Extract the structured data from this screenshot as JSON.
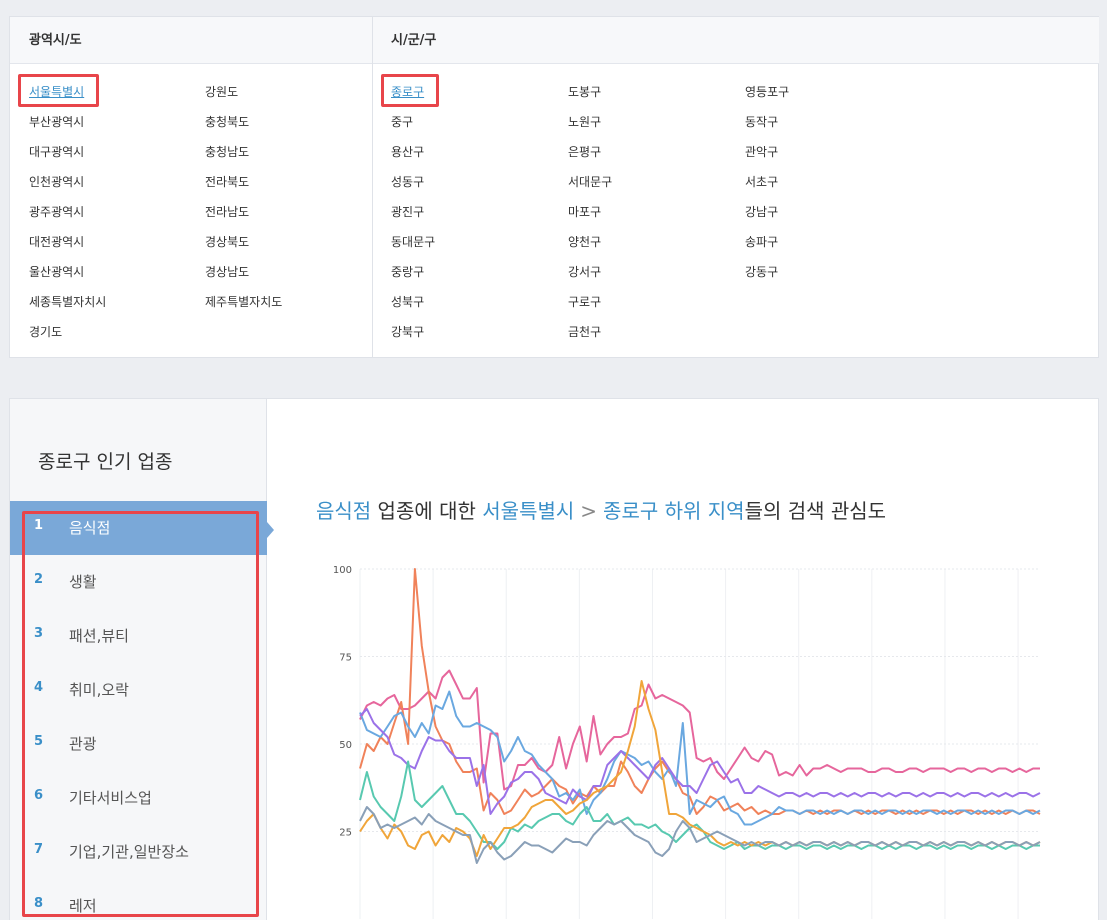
{
  "region": {
    "province_header": "광역시/도",
    "district_header": "시/군/구",
    "provinces": [
      "서울특별시",
      "부산광역시",
      "대구광역시",
      "인천광역시",
      "광주광역시",
      "대전광역시",
      "울산광역시",
      "세종특별자치시",
      "경기도",
      "강원도",
      "충청북도",
      "충청남도",
      "전라북도",
      "전라남도",
      "경상북도",
      "경상남도",
      "제주특별자치도"
    ],
    "districts": [
      "종로구",
      "중구",
      "용산구",
      "성동구",
      "광진구",
      "동대문구",
      "중랑구",
      "성북구",
      "강북구",
      "도봉구",
      "노원구",
      "은평구",
      "서대문구",
      "마포구",
      "양천구",
      "강서구",
      "구로구",
      "금천구",
      "영등포구",
      "동작구",
      "관악구",
      "서초구",
      "강남구",
      "송파구",
      "강동구"
    ],
    "selected_province": "서울특별시",
    "selected_district": "종로구"
  },
  "popular": {
    "title": "종로구 인기 업종",
    "categories": [
      {
        "rank": "1",
        "label": "음식점"
      },
      {
        "rank": "2",
        "label": "생활"
      },
      {
        "rank": "3",
        "label": "패션,뷰티"
      },
      {
        "rank": "4",
        "label": "취미,오락"
      },
      {
        "rank": "5",
        "label": "관광"
      },
      {
        "rank": "6",
        "label": "기타서비스업"
      },
      {
        "rank": "7",
        "label": "기업,기관,일반장소"
      },
      {
        "rank": "8",
        "label": "레저"
      }
    ],
    "headline": {
      "category": "음식점",
      "text1": " 업종에 대한 ",
      "region": "서울특별시",
      "separator": ">",
      "district": "종로구 하위 지역",
      "text2": "들의 검색 관심도"
    }
  },
  "colors": {
    "accent": "#3a8fc8",
    "active_bg": "#7aa8d8",
    "highlight": "#e8454a"
  },
  "chart_data": {
    "type": "line",
    "title": "",
    "xlabel": "",
    "ylabel": "",
    "ylim": [
      0,
      100
    ],
    "yticks": [
      "100",
      "75",
      "50",
      "25"
    ],
    "grid": true,
    "x": [
      1,
      2,
      3,
      4,
      5,
      6,
      7,
      8,
      9,
      10,
      11,
      12,
      13,
      14,
      15,
      16,
      17,
      18,
      19,
      20,
      21,
      22,
      23,
      24,
      25,
      26,
      27,
      28,
      29,
      30,
      31,
      32,
      33,
      34,
      35,
      36,
      37,
      38,
      39,
      40,
      41,
      42,
      43,
      44,
      45,
      46,
      47,
      48,
      49,
      50,
      51,
      52,
      53,
      54,
      55,
      56,
      57,
      58,
      59,
      60,
      61,
      62,
      63,
      64,
      65,
      66,
      67,
      68,
      69,
      70,
      71,
      72,
      73,
      74,
      75,
      76,
      77,
      78,
      79,
      80,
      81,
      82,
      83,
      84,
      85,
      86,
      87,
      88,
      89,
      90,
      91,
      92,
      93,
      94,
      95,
      96,
      97,
      98,
      99,
      100
    ],
    "series": [
      {
        "color": "#e6669c",
        "values": [
          57,
          61,
          62,
          61,
          63,
          64,
          60,
          60,
          61,
          63,
          65,
          63,
          69,
          71,
          67,
          63,
          63,
          66,
          39,
          53,
          53,
          37,
          38,
          44,
          44,
          46,
          43,
          42,
          44,
          52,
          43,
          50,
          55,
          45,
          58,
          47,
          50,
          52,
          52,
          53,
          60,
          61,
          67,
          63,
          64,
          63,
          62,
          61,
          59,
          46,
          45,
          46,
          42,
          40,
          43,
          46,
          49,
          46,
          45,
          48,
          47,
          41,
          42,
          41,
          44,
          41,
          43,
          43,
          44,
          43,
          42,
          43,
          43,
          43,
          42,
          42,
          43,
          43,
          42,
          42,
          43,
          43,
          42,
          43,
          43,
          43,
          42,
          43,
          43,
          42,
          43,
          43,
          42,
          43,
          43,
          42,
          43,
          42,
          43,
          43
        ]
      },
      {
        "color": "#f0825a",
        "values": [
          43,
          50,
          48,
          52,
          50,
          56,
          62,
          50,
          100,
          78,
          65,
          55,
          51,
          50,
          45,
          42,
          42,
          43,
          31,
          36,
          34,
          30,
          31,
          34,
          37,
          35,
          36,
          38,
          40,
          38,
          37,
          33,
          36,
          35,
          38,
          36,
          38,
          38,
          45,
          42,
          38,
          36,
          40,
          43,
          45,
          42,
          40,
          36,
          35,
          30,
          32,
          35,
          34,
          31,
          32,
          33,
          31,
          32,
          30,
          31,
          30,
          30,
          31,
          31,
          30,
          31,
          30,
          31,
          30,
          31,
          31,
          30,
          31,
          30,
          31,
          30,
          31,
          31,
          30,
          31,
          30,
          31,
          30,
          31,
          31,
          30,
          31,
          30,
          31,
          31,
          30,
          31,
          30,
          31,
          30,
          31,
          30,
          31,
          31,
          30
        ]
      },
      {
        "color": "#6aa8e0",
        "values": [
          59,
          54,
          53,
          52,
          55,
          58,
          59,
          55,
          52,
          56,
          53,
          61,
          60,
          65,
          58,
          55,
          55,
          56,
          55,
          54,
          52,
          45,
          48,
          52,
          48,
          47,
          44,
          42,
          40,
          35,
          36,
          34,
          37,
          30,
          34,
          36,
          40,
          45,
          48,
          47,
          46,
          44,
          45,
          42,
          40,
          43,
          38,
          56,
          30,
          34,
          33,
          32,
          34,
          35,
          31,
          30,
          27,
          27,
          28,
          29,
          30,
          32,
          31,
          31,
          30,
          31,
          31,
          30,
          31,
          30,
          31,
          30,
          31,
          31,
          30,
          31,
          30,
          31,
          31,
          30,
          31,
          30,
          31,
          31,
          30,
          31,
          30,
          31,
          31,
          30,
          31,
          30,
          31,
          30,
          31,
          31,
          30,
          31,
          30,
          31
        ]
      },
      {
        "color": "#9b72e8",
        "values": [
          58,
          60,
          56,
          54,
          52,
          47,
          46,
          44,
          43,
          48,
          52,
          51,
          51,
          48,
          46,
          46,
          46,
          38,
          44,
          30,
          33,
          35,
          39,
          40,
          42,
          42,
          40,
          36,
          35,
          34,
          33,
          37,
          35,
          34,
          38,
          38,
          44,
          46,
          48,
          46,
          44,
          42,
          40,
          44,
          46,
          43,
          40,
          38,
          38,
          36,
          40,
          44,
          45,
          42,
          39,
          40,
          36,
          36,
          38,
          37,
          36,
          35,
          36,
          36,
          35,
          36,
          35,
          36,
          36,
          35,
          36,
          35,
          36,
          35,
          36,
          36,
          35,
          36,
          35,
          36,
          36,
          35,
          36,
          35,
          36,
          36,
          35,
          36,
          35,
          36,
          36,
          35,
          36,
          35,
          36,
          35,
          36,
          36,
          35,
          36
        ]
      },
      {
        "color": "#58c9b0",
        "values": [
          34,
          42,
          35,
          32,
          30,
          28,
          35,
          45,
          34,
          32,
          34,
          36,
          38,
          34,
          30,
          30,
          28,
          25,
          22,
          22,
          20,
          22,
          26,
          25,
          27,
          26,
          28,
          29,
          30,
          30,
          28,
          27,
          30,
          32,
          28,
          28,
          30,
          27,
          28,
          29,
          27,
          27,
          26,
          27,
          25,
          24,
          22,
          24,
          26,
          27,
          25,
          22,
          21,
          20,
          21,
          22,
          20,
          21,
          21,
          20,
          21,
          21,
          20,
          21,
          21,
          20,
          21,
          21,
          20,
          21,
          20,
          21,
          21,
          20,
          21,
          21,
          20,
          21,
          20,
          21,
          21,
          20,
          21,
          21,
          20,
          21,
          20,
          21,
          21,
          20,
          21,
          21,
          20,
          21,
          20,
          21,
          21,
          20,
          21,
          21
        ]
      },
      {
        "color": "#f0a53a",
        "values": [
          25,
          28,
          30,
          26,
          23,
          27,
          25,
          21,
          20,
          24,
          25,
          21,
          24,
          22,
          26,
          25,
          23,
          18,
          24,
          20,
          23,
          26,
          26,
          27,
          29,
          32,
          33,
          34,
          34,
          32,
          30,
          31,
          33,
          34,
          36,
          37,
          38,
          40,
          42,
          48,
          55,
          68,
          60,
          54,
          42,
          30,
          30,
          29,
          27,
          26,
          25,
          24,
          22,
          21,
          22,
          21,
          22,
          21,
          22,
          21,
          22,
          21,
          22,
          21,
          22,
          21,
          22,
          22,
          21,
          22,
          21,
          22,
          21,
          22,
          22,
          21,
          22,
          21,
          22,
          21,
          22,
          22,
          21,
          22,
          21,
          22,
          21,
          22,
          22,
          21,
          22,
          21,
          22,
          21,
          22,
          22,
          21,
          22,
          21,
          22
        ]
      },
      {
        "color": "#8aa0b8",
        "values": [
          28,
          32,
          30,
          26,
          27,
          26,
          27,
          28,
          29,
          27,
          30,
          28,
          27,
          26,
          25,
          24,
          24,
          16,
          20,
          22,
          19,
          17,
          18,
          20,
          22,
          21,
          21,
          20,
          19,
          21,
          23,
          22,
          22,
          21,
          24,
          26,
          28,
          27,
          28,
          26,
          24,
          23,
          22,
          19,
          18,
          20,
          25,
          28,
          26,
          22,
          23,
          24,
          25,
          24,
          23,
          22,
          21,
          22,
          21,
          22,
          22,
          21,
          22,
          21,
          22,
          21,
          22,
          22,
          21,
          22,
          21,
          22,
          21,
          22,
          22,
          21,
          22,
          21,
          22,
          21,
          22,
          22,
          21,
          22,
          21,
          22,
          21,
          22,
          22,
          21,
          22,
          21,
          22,
          21,
          22,
          22,
          21,
          22,
          21,
          22
        ]
      }
    ]
  }
}
